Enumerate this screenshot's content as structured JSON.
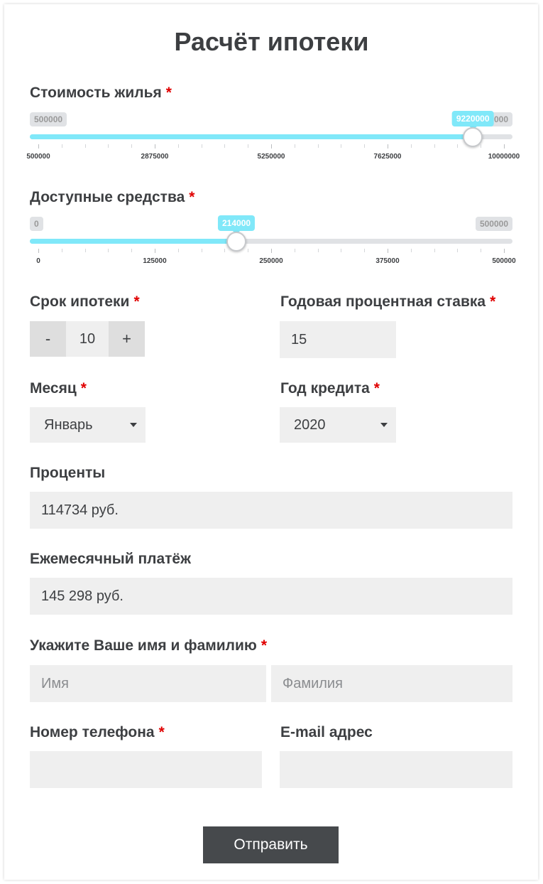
{
  "title": "Расчёт ипотеки",
  "required_mark": "*",
  "price": {
    "label": "Стоимость жилья",
    "min_label": "500000",
    "max_label": "10000000",
    "current": "9220000",
    "fraction": 0.9179,
    "ticks": [
      "500000",
      "2875000",
      "5250000",
      "7625000",
      "10000000"
    ]
  },
  "funds": {
    "label": "Доступные средства",
    "min_label": "0",
    "max_label": "500000",
    "current": "214000",
    "fraction": 0.428,
    "ticks": [
      "0",
      "125000",
      "250000",
      "375000",
      "500000"
    ]
  },
  "term": {
    "label": "Срок ипотеки",
    "minus": "-",
    "value": "10",
    "plus": "+"
  },
  "rate": {
    "label": "Годовая процентная ставка",
    "value": "15"
  },
  "month": {
    "label": "Месяц",
    "value": "Январь"
  },
  "year": {
    "label": "Год кредита",
    "value": "2020"
  },
  "interest": {
    "label": "Проценты",
    "value": "114734 руб."
  },
  "payment": {
    "label": "Ежемесячный платёж",
    "value": "145 298 руб."
  },
  "name": {
    "label": "Укажите Ваше имя и фамилию",
    "first_placeholder": "Имя",
    "last_placeholder": "Фамилия"
  },
  "phone": {
    "label": "Номер телефона"
  },
  "email": {
    "label": "E-mail адрес"
  },
  "submit": "Отправить",
  "colors": {
    "accent": "#80e8f9",
    "required": "#e00000",
    "button": "#46494c",
    "field": "#efefef"
  }
}
